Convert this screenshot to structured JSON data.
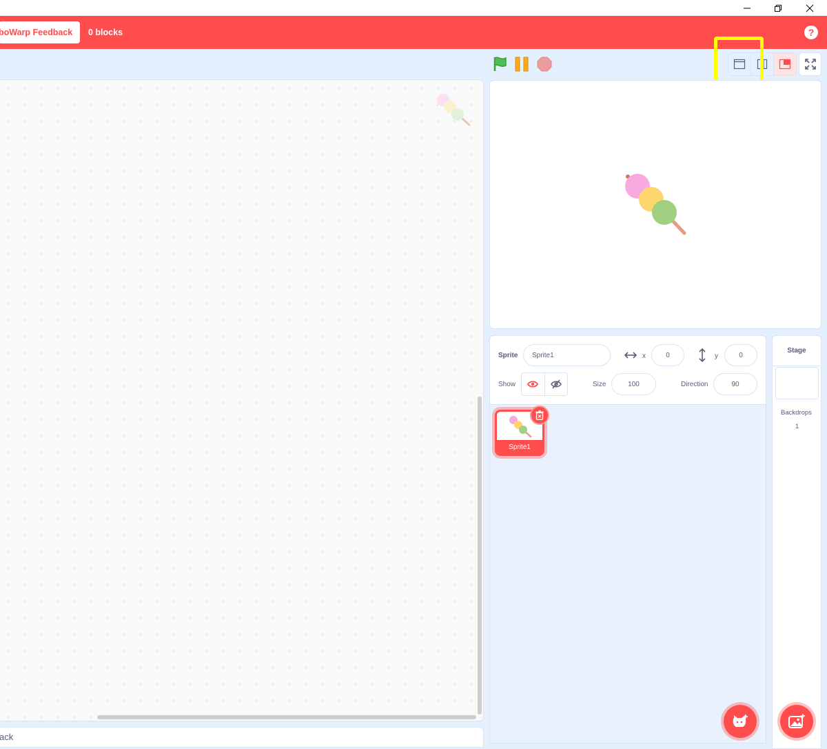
{
  "menu": {
    "feedback_label": "boWarp Feedback",
    "blocks_count": "0 blocks"
  },
  "bottom_bar": {
    "text": "ack"
  },
  "sprite_info": {
    "sprite_label": "Sprite",
    "sprite_name": "Sprite1",
    "x_label": "x",
    "x_value": "0",
    "y_label": "y",
    "y_value": "0",
    "show_label": "Show",
    "size_label": "Size",
    "size_value": "100",
    "direction_label": "Direction",
    "direction_value": "90"
  },
  "sprites": [
    {
      "name": "Sprite1"
    }
  ],
  "stage_panel": {
    "title": "Stage",
    "backdrops_label": "Backdrops",
    "backdrops_count": "1"
  },
  "colors": {
    "brand": "#ff4c4c",
    "highlight": "#ffff00",
    "green_flag": "#4cbf56",
    "pause": "#ffab19"
  }
}
